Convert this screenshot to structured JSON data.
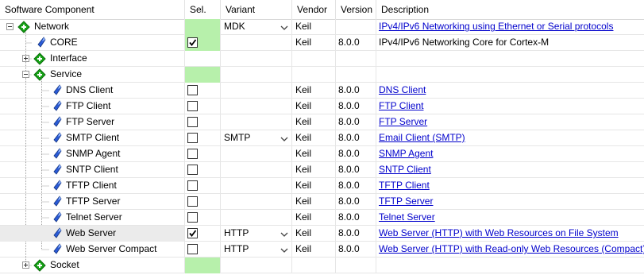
{
  "columns": [
    "Software Component",
    "Sel.",
    "Variant",
    "Vendor",
    "Version",
    "Description"
  ],
  "rows": [
    {
      "name": "Network",
      "level": 0,
      "expander": "minus",
      "icon": "green-diamond-icon",
      "sel": "green",
      "variant": "MDK",
      "dropdown": true,
      "vendor": "Keil",
      "version": "",
      "desc": "IPv4/IPv6 Networking using Ethernet or Serial protocols",
      "link": true
    },
    {
      "name": "CORE",
      "level": 1,
      "expander": "",
      "icon": "blue-gem-icon",
      "sel": "checked-green",
      "variant": "",
      "dropdown": false,
      "vendor": "Keil",
      "version": "8.0.0",
      "desc": "IPv4/IPv6 Networking Core for Cortex-M",
      "link": false
    },
    {
      "name": "Interface",
      "level": 1,
      "expander": "plus",
      "icon": "green-diamond-icon",
      "sel": "none",
      "variant": "",
      "dropdown": false,
      "vendor": "",
      "version": "",
      "desc": "",
      "link": false
    },
    {
      "name": "Service",
      "level": 1,
      "expander": "minus",
      "icon": "green-diamond-icon",
      "sel": "green",
      "variant": "",
      "dropdown": false,
      "vendor": "",
      "version": "",
      "desc": "",
      "link": false
    },
    {
      "name": "DNS Client",
      "level": 2,
      "expander": "",
      "icon": "blue-gem-icon",
      "sel": "unchecked",
      "variant": "",
      "dropdown": false,
      "vendor": "Keil",
      "version": "8.0.0",
      "desc": "DNS Client",
      "link": true
    },
    {
      "name": "FTP Client",
      "level": 2,
      "expander": "",
      "icon": "blue-gem-icon",
      "sel": "unchecked",
      "variant": "",
      "dropdown": false,
      "vendor": "Keil",
      "version": "8.0.0",
      "desc": "FTP Client",
      "link": true
    },
    {
      "name": "FTP Server",
      "level": 2,
      "expander": "",
      "icon": "blue-gem-icon",
      "sel": "unchecked",
      "variant": "",
      "dropdown": false,
      "vendor": "Keil",
      "version": "8.0.0",
      "desc": "FTP Server",
      "link": true
    },
    {
      "name": "SMTP Client",
      "level": 2,
      "expander": "",
      "icon": "blue-gem-icon",
      "sel": "unchecked",
      "variant": "SMTP",
      "dropdown": true,
      "vendor": "Keil",
      "version": "8.0.0",
      "desc": "Email Client (SMTP)",
      "link": true
    },
    {
      "name": "SNMP Agent",
      "level": 2,
      "expander": "",
      "icon": "blue-gem-icon",
      "sel": "unchecked",
      "variant": "",
      "dropdown": false,
      "vendor": "Keil",
      "version": "8.0.0",
      "desc": "SNMP Agent",
      "link": true
    },
    {
      "name": "SNTP Client",
      "level": 2,
      "expander": "",
      "icon": "blue-gem-icon",
      "sel": "unchecked",
      "variant": "",
      "dropdown": false,
      "vendor": "Keil",
      "version": "8.0.0",
      "desc": "SNTP Client",
      "link": true
    },
    {
      "name": "TFTP Client",
      "level": 2,
      "expander": "",
      "icon": "blue-gem-icon",
      "sel": "unchecked",
      "variant": "",
      "dropdown": false,
      "vendor": "Keil",
      "version": "8.0.0",
      "desc": "TFTP Client",
      "link": true
    },
    {
      "name": "TFTP Server",
      "level": 2,
      "expander": "",
      "icon": "blue-gem-icon",
      "sel": "unchecked",
      "variant": "",
      "dropdown": false,
      "vendor": "Keil",
      "version": "8.0.0",
      "desc": "TFTP Server",
      "link": true
    },
    {
      "name": "Telnet Server",
      "level": 2,
      "expander": "",
      "icon": "blue-gem-icon",
      "sel": "unchecked",
      "variant": "",
      "dropdown": false,
      "vendor": "Keil",
      "version": "8.0.0",
      "desc": "Telnet Server",
      "link": true
    },
    {
      "name": "Web Server",
      "level": 2,
      "expander": "",
      "icon": "blue-gem-icon",
      "sel": "checked",
      "variant": "HTTP",
      "dropdown": true,
      "vendor": "Keil",
      "version": "8.0.0",
      "desc": "Web Server (HTTP) with Web Resources on File System",
      "link": true,
      "selected": true
    },
    {
      "name": "Web Server Compact",
      "level": 2,
      "expander": "",
      "icon": "blue-gem-icon",
      "sel": "unchecked",
      "variant": "HTTP",
      "dropdown": true,
      "vendor": "Keil",
      "version": "8.0.0",
      "desc": "Web Server (HTTP) with Read-only Web Resources (Compact)",
      "link": true
    },
    {
      "name": "Socket",
      "level": 1,
      "expander": "plus",
      "icon": "green-diamond-icon",
      "sel": "green",
      "variant": "",
      "dropdown": false,
      "vendor": "",
      "version": "",
      "desc": "",
      "link": false
    }
  ],
  "colors": {
    "selection_green": "#b7f0ab",
    "link": "#0000cc",
    "gem_blue": "#2a5bd7",
    "diamond_green": "#17a417"
  }
}
